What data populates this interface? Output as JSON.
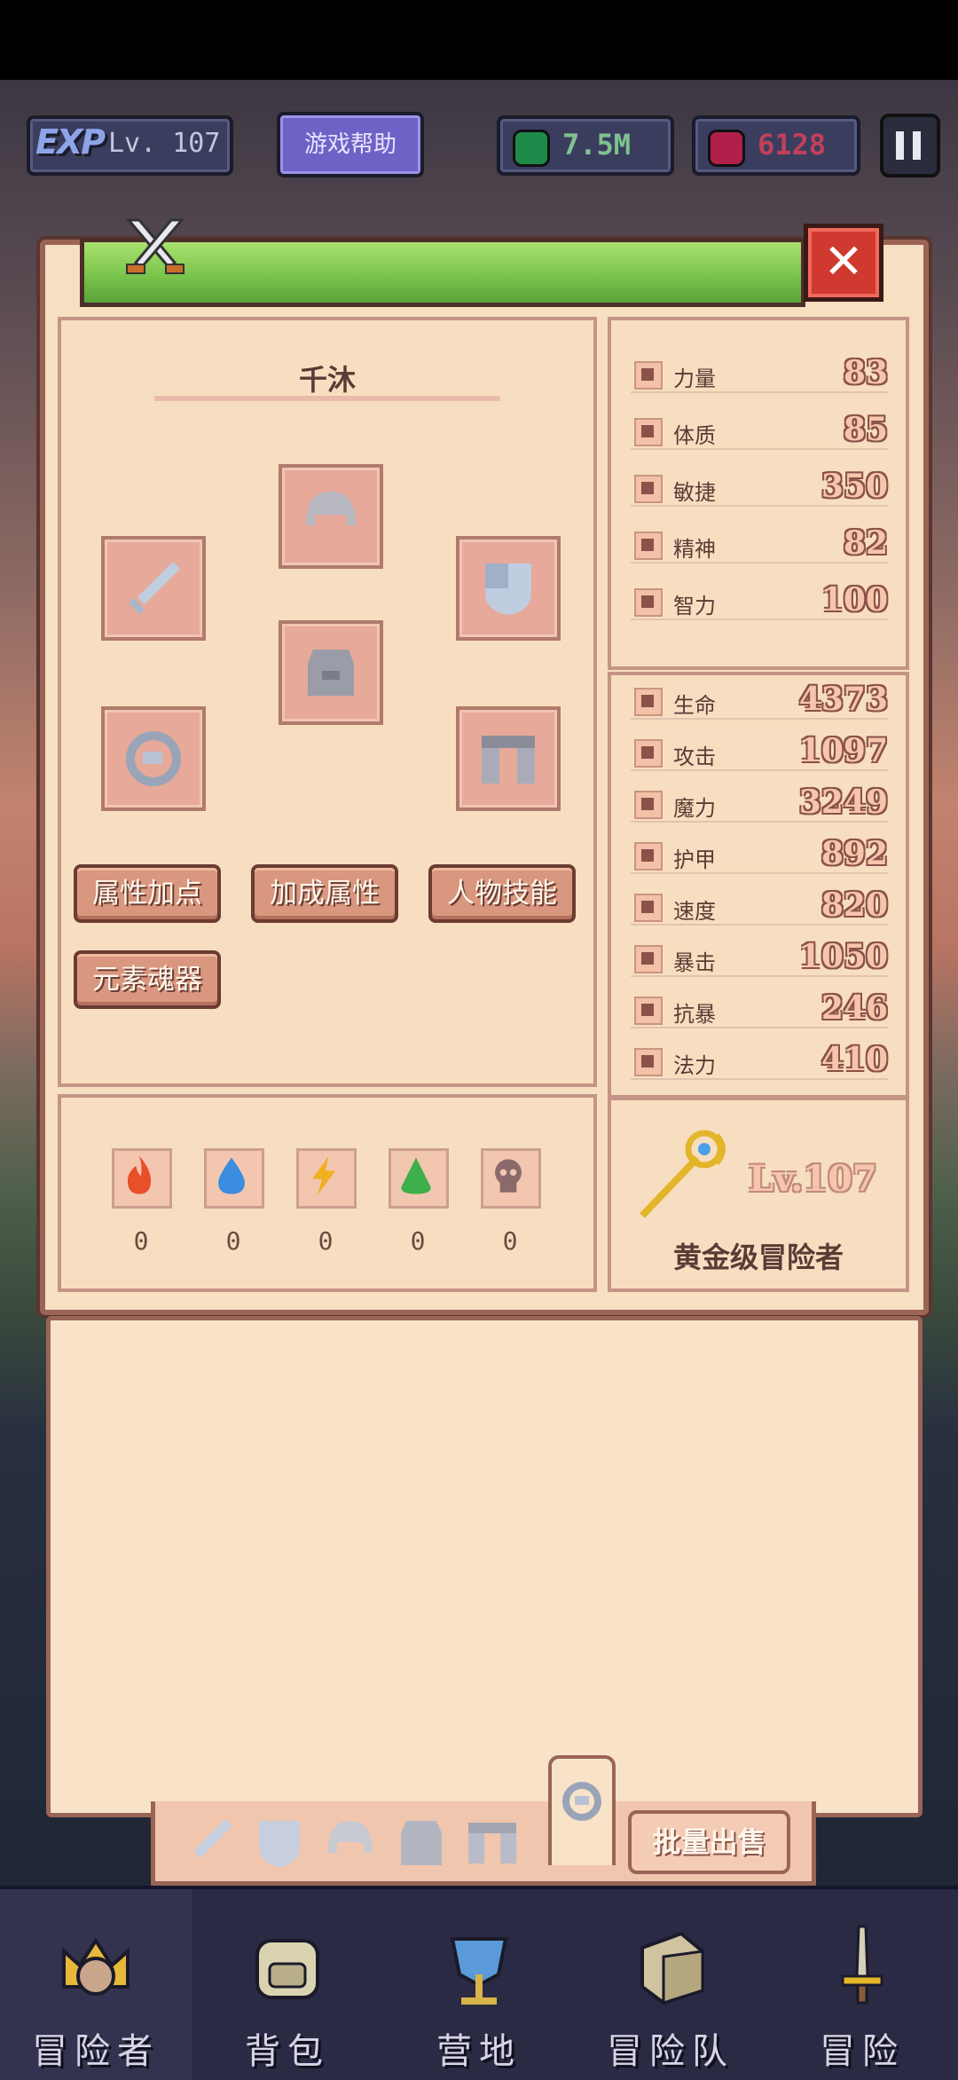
{
  "hud": {
    "exp_tag": "EXP",
    "level": "Lv. 107",
    "help_button": "游戏帮助",
    "gems": "7.5M",
    "rubies": "6128",
    "gem_color": "#1e8a4a",
    "ruby_color": "#b0204a"
  },
  "panel": {
    "close_label": "✕",
    "character_name": "千沐",
    "buttons": [
      "属性加点",
      "加成属性",
      "人物技能",
      "元素魂器"
    ]
  },
  "equipment_slots": [
    "helmet-icon",
    "sword-icon",
    "shield-icon",
    "armor-icon",
    "ring-icon",
    "boots-icon"
  ],
  "elements": [
    {
      "name": "fire-icon",
      "value": "0",
      "color": "#e8502a"
    },
    {
      "name": "water-icon",
      "value": "0",
      "color": "#3a8de0"
    },
    {
      "name": "lightning-icon",
      "value": "0",
      "color": "#f0b020"
    },
    {
      "name": "earth-icon",
      "value": "0",
      "color": "#3cb04a"
    },
    {
      "name": "dark-icon",
      "value": "0",
      "color": "#8a6a6a"
    }
  ],
  "base_stats": [
    {
      "label": "力量",
      "value": "83"
    },
    {
      "label": "体质",
      "value": "85"
    },
    {
      "label": "敏捷",
      "value": "350"
    },
    {
      "label": "精神",
      "value": "82"
    },
    {
      "label": "智力",
      "value": "100"
    }
  ],
  "combat_stats": [
    {
      "label": "生命",
      "value": "4373"
    },
    {
      "label": "攻击",
      "value": "1097"
    },
    {
      "label": "魔力",
      "value": "3249"
    },
    {
      "label": "护甲",
      "value": "892"
    },
    {
      "label": "速度",
      "value": "820"
    },
    {
      "label": "暴击",
      "value": "1050"
    },
    {
      "label": "抗暴",
      "value": "246"
    },
    {
      "label": "法力",
      "value": "410"
    }
  ],
  "rank": {
    "level": "Lv.107",
    "title": "黄金级冒险者"
  },
  "inventory": {
    "tabs": [
      "sword-icon",
      "shield-icon",
      "helmet-icon",
      "armor-icon",
      "boots-icon",
      "ring-icon"
    ],
    "active_tab": "ring-icon",
    "bulk_sell": "批量出售"
  },
  "nav": [
    {
      "label": "冒险者",
      "icon": "crown-icon"
    },
    {
      "label": "背包",
      "icon": "backpack-icon"
    },
    {
      "label": "营地",
      "icon": "camp-icon"
    },
    {
      "label": "冒险队",
      "icon": "book-icon"
    },
    {
      "label": "冒险",
      "icon": "sword-icon"
    }
  ]
}
